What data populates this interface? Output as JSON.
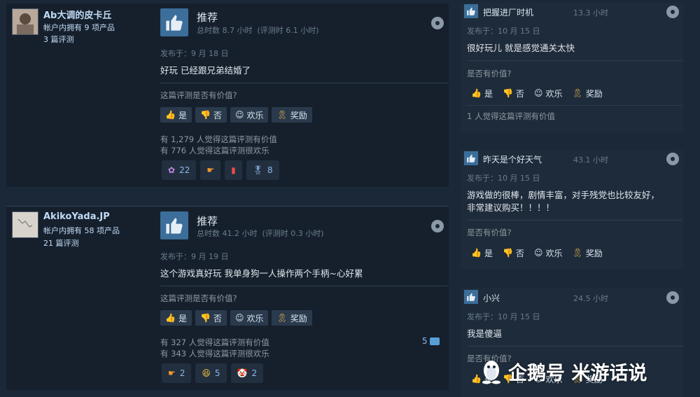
{
  "left_reviews": [
    {
      "author": {
        "name": "Ab大调的皮卡丘",
        "products": "帐户内拥有 9 项产品",
        "reviews": "3 篇评测"
      },
      "verdict": "推荐",
      "hours": "总时数 8.7 小时  (评测时 6.1 小时)",
      "posted": "发布于：9 月 18 日",
      "content": "好玩 已经跟兄弟结婚了",
      "helpful_question": "这篇评测是否有价值?",
      "vote_buttons": {
        "yes": "是",
        "no": "否",
        "funny": "欢乐",
        "award": "奖励"
      },
      "helpful_count": "有 1,279 人觉得这篇评测有价值",
      "funny_count": "有 776 人觉得这篇评测很欢乐",
      "awards": [
        {
          "icon": "wings-icon",
          "count": "22"
        },
        {
          "icon": "pointing-hand-icon",
          "count": ""
        },
        {
          "icon": "soda-can-icon",
          "count": ""
        },
        {
          "icon": "medal-icon",
          "count": "8"
        }
      ]
    },
    {
      "author": {
        "name": "AkikoYada.JP",
        "products": "帐户内拥有 58 项产品",
        "reviews": "21 篇评测"
      },
      "verdict": "推荐",
      "hours": "总时数 41.2 小时  (评测时 0.3 小时)",
      "posted": "发布于：9 月 19 日",
      "content": "这个游戏真好玩 我单身狗一人操作两个手柄~心好累",
      "helpful_question": "这篇评测是否有价值?",
      "vote_buttons": {
        "yes": "是",
        "no": "否",
        "funny": "欢乐",
        "award": "奖励"
      },
      "helpful_count": "有 327 人觉得这篇评测有价值",
      "funny_count": "有 343 人觉得这篇评测很欢乐",
      "comment_count": "5",
      "awards": [
        {
          "icon": "pointing-hand-icon",
          "count": "2"
        },
        {
          "icon": "laughing-face-icon",
          "count": "5"
        },
        {
          "icon": "clown-icon",
          "count": "2"
        }
      ]
    }
  ],
  "right_reviews": [
    {
      "name": "把握进厂时机",
      "hours": "13.3 小时",
      "posted": "发布于：10 月 15 日",
      "content": "很好玩儿 就是感觉通关太快",
      "helpful_question": "是否有价值?",
      "vote_buttons": {
        "yes": "是",
        "no": "否",
        "funny": "欢乐",
        "award": "奖励"
      },
      "helpful_note": "1 人觉得这篇评测有价值"
    },
    {
      "name": "昨天是个好天气",
      "hours": "43.1 小时",
      "posted": "发布于：10 月 15 日",
      "content_line1": "游戏做的很棒，剧情丰富，对手残党也比较友好，",
      "content_line2": "非常建议购买！！！！",
      "helpful_question": "是否有价值?",
      "vote_buttons": {
        "yes": "是",
        "no": "否",
        "funny": "欢乐",
        "award": "奖励"
      }
    },
    {
      "name": "小兴",
      "hours": "24.5 小时",
      "posted": "发布于：10 月 15 日",
      "content": "我是傻逼",
      "helpful_question": "是否有价值?",
      "vote_buttons": {
        "yes": "是",
        "no": "否",
        "funny": "欢乐",
        "award": "奖励"
      }
    }
  ],
  "watermark": "企鹅号 米游话说",
  "colors": {
    "background": "#1b2838",
    "panel": "#16202d",
    "thumb": "#3b6e9a",
    "link": "#c1dbf4"
  }
}
